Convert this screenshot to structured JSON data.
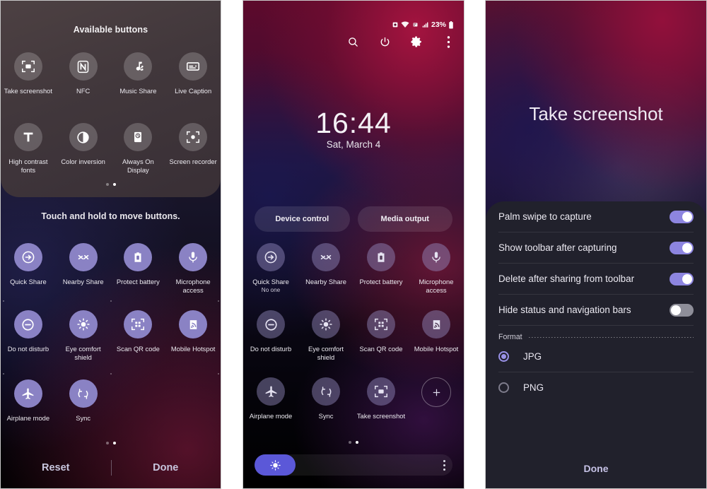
{
  "panel1": {
    "available_title": "Available buttons",
    "move_hint": "Touch and hold to move buttons.",
    "available_buttons": [
      {
        "label": "Take screenshot",
        "icon": "screenshot-icon"
      },
      {
        "label": "NFC",
        "icon": "nfc-icon"
      },
      {
        "label": "Music Share",
        "icon": "music-share-icon"
      },
      {
        "label": "Live Caption",
        "icon": "live-caption-icon"
      },
      {
        "label": "High contrast fonts",
        "icon": "high-contrast-fonts-icon"
      },
      {
        "label": "Color inversion",
        "icon": "color-inversion-icon"
      },
      {
        "label": "Always On Display",
        "icon": "always-on-display-icon"
      },
      {
        "label": "Screen recorder",
        "icon": "screen-recorder-icon"
      }
    ],
    "active_buttons": [
      {
        "label": "Quick Share",
        "icon": "quick-share-icon"
      },
      {
        "label": "Nearby Share",
        "icon": "nearby-share-icon"
      },
      {
        "label": "Protect battery",
        "icon": "protect-battery-icon"
      },
      {
        "label": "Microphone access",
        "icon": "microphone-icon"
      },
      {
        "label": "Do not disturb",
        "icon": "do-not-disturb-icon"
      },
      {
        "label": "Eye comfort shield",
        "icon": "eye-comfort-shield-icon"
      },
      {
        "label": "Scan QR code",
        "icon": "scan-qr-code-icon"
      },
      {
        "label": "Mobile Hotspot",
        "icon": "mobile-hotspot-icon"
      },
      {
        "label": "Airplane mode",
        "icon": "airplane-mode-icon"
      },
      {
        "label": "Sync",
        "icon": "sync-icon"
      }
    ],
    "reset_label": "Reset",
    "done_label": "Done",
    "page_dots": {
      "count": 2,
      "active_index": 1
    }
  },
  "panel2": {
    "status": {
      "battery_percent": "23%",
      "icons": [
        "alarm-icon",
        "wifi-icon",
        "usb-icon",
        "signal-icon",
        "battery-icon"
      ]
    },
    "header_icons": [
      "search-icon",
      "power-icon",
      "settings-icon",
      "more-options-icon"
    ],
    "clock": "16:44",
    "date": "Sat, March 4",
    "pills": [
      {
        "label": "Device control"
      },
      {
        "label": "Media output"
      }
    ],
    "tiles": [
      {
        "label": "Quick Share",
        "sub": "No one",
        "icon": "quick-share-icon"
      },
      {
        "label": "Nearby Share",
        "sub": "",
        "icon": "nearby-share-icon"
      },
      {
        "label": "Protect battery",
        "sub": "",
        "icon": "protect-battery-icon"
      },
      {
        "label": "Microphone access",
        "sub": "",
        "icon": "microphone-icon"
      },
      {
        "label": "Do not disturb",
        "sub": "",
        "icon": "do-not-disturb-icon"
      },
      {
        "label": "Eye comfort shield",
        "sub": "",
        "icon": "eye-comfort-shield-icon"
      },
      {
        "label": "Scan QR code",
        "sub": "",
        "icon": "scan-qr-code-icon"
      },
      {
        "label": "Mobile Hotspot",
        "sub": "",
        "icon": "mobile-hotspot-icon"
      },
      {
        "label": "Airplane mode",
        "sub": "",
        "icon": "airplane-mode-icon"
      },
      {
        "label": "Sync",
        "sub": "",
        "icon": "sync-icon"
      },
      {
        "label": "Take screenshot",
        "sub": "",
        "icon": "screenshot-icon"
      },
      {
        "label": "",
        "sub": "",
        "icon": "add-icon"
      }
    ],
    "page_dots": {
      "count": 2,
      "active_index": 1
    },
    "brightness": {
      "icon": "brightness-icon",
      "more_icon": "brightness-more-icon"
    }
  },
  "panel3": {
    "title": "Take screenshot",
    "settings": [
      {
        "label": "Palm swipe to capture",
        "state": "on"
      },
      {
        "label": "Show toolbar after capturing",
        "state": "on"
      },
      {
        "label": "Delete after sharing from toolbar",
        "state": "on"
      },
      {
        "label": "Hide status and navigation bars",
        "state": "off"
      }
    ],
    "format_label": "Format",
    "format_options": [
      {
        "label": "JPG",
        "selected": true
      },
      {
        "label": "PNG",
        "selected": false
      }
    ],
    "done_label": "Done"
  },
  "colors": {
    "accent_purple": "#8a82c4",
    "toggle_on": "#8d85e0",
    "toggle_off": "#8e8e99",
    "brightness_fill": "#5b58d8",
    "sheet_bg": "#21212c",
    "done_text": "#c6c2e6"
  }
}
